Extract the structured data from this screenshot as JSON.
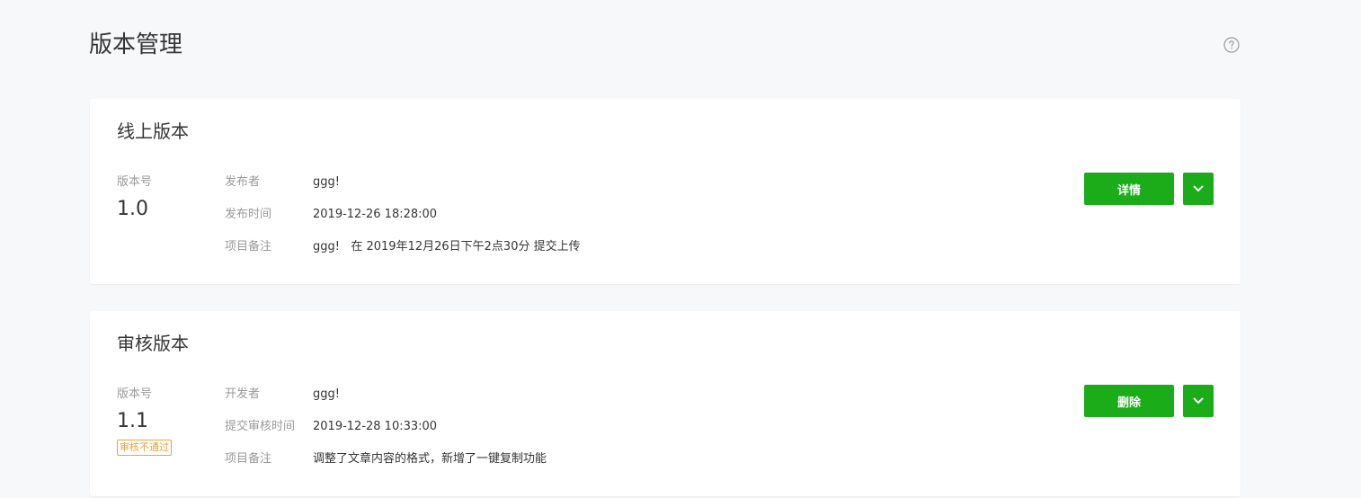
{
  "page": {
    "title": "版本管理",
    "help_icon": "question-circle-icon"
  },
  "online_version": {
    "section_title": "线上版本",
    "version_label": "版本号",
    "version_number": "1.0",
    "fields": [
      {
        "key": "发布者",
        "value": "ggg!"
      },
      {
        "key": "发布时间",
        "value": "2019-12-26 18:28:00"
      },
      {
        "key": "项目备注",
        "value": "ggg!   在 2019年12月26日下午2点30分 提交上传"
      }
    ],
    "primary_button": "详情",
    "dropdown_icon": "chevron-down-icon"
  },
  "review_version": {
    "section_title": "审核版本",
    "version_label": "版本号",
    "version_number": "1.1",
    "status_badge": "审核不通过",
    "fields": [
      {
        "key": "开发者",
        "value": "ggg!"
      },
      {
        "key": "提交审核时间",
        "value": "2019-12-28 10:33:00"
      },
      {
        "key": "项目备注",
        "value": "调整了文章内容的格式，新增了一键复制功能"
      }
    ],
    "primary_button": "删除",
    "dropdown_icon": "chevron-down-icon"
  },
  "colors": {
    "accent": "#1aad19",
    "background": "#f7f8fa",
    "status_warning": "#e6a23c"
  }
}
